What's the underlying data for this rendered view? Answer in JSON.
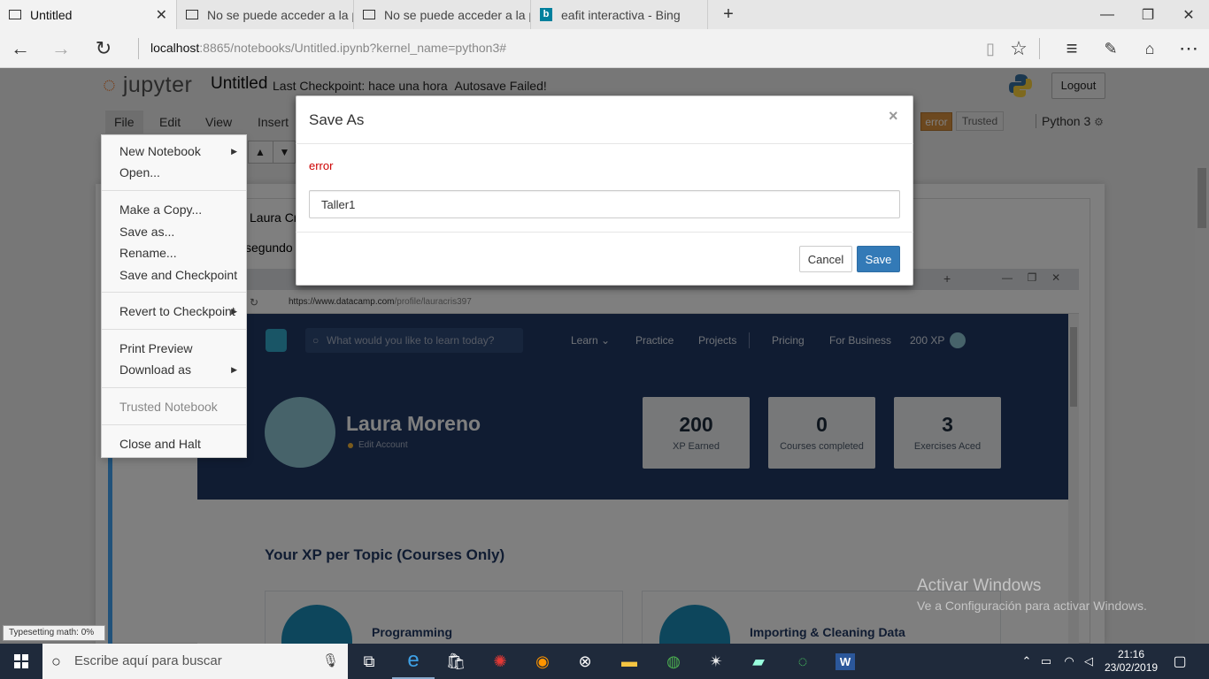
{
  "browser": {
    "tabs": [
      {
        "title": "Untitled",
        "active": true
      },
      {
        "title": "No se puede acceder a la pá"
      },
      {
        "title": "No se puede acceder a la pá"
      },
      {
        "title": "eafit interactiva - Bing"
      }
    ],
    "new_tab": "+",
    "url_host": "localhost",
    "url_rest": ":8865/notebooks/Untitled.ipynb?kernel_name=python3#",
    "window_controls": {
      "minimize": "—",
      "restore": "❐",
      "close": "✕"
    }
  },
  "jupyter": {
    "logo": "jupyter",
    "notebook_title": "Untitled",
    "checkpoint": "Last Checkpoint: hace una hora",
    "autosave": "Autosave Failed!",
    "logout": "Logout",
    "menus": [
      "File",
      "Edit",
      "View",
      "Insert"
    ],
    "file_menu": {
      "groups": [
        [
          {
            "label": "New Notebook",
            "submenu": true
          },
          {
            "label": "Open..."
          }
        ],
        [
          {
            "label": "Make a Copy..."
          },
          {
            "label": "Save as..."
          },
          {
            "label": "Rename..."
          },
          {
            "label": "Save and Checkpoint"
          }
        ],
        [
          {
            "label": "Revert to Checkpoint",
            "submenu": true
          }
        ],
        [
          {
            "label": "Print Preview"
          },
          {
            "label": "Download as",
            "submenu": true
          }
        ],
        [
          {
            "label": "Trusted Notebook",
            "disabled": true
          }
        ],
        [
          {
            "label": "Close and Halt"
          }
        ]
      ]
    },
    "error_badge": "error",
    "trusted": "Trusted",
    "kernel": "Python 3",
    "typesetting": "Typesetting math: 0%",
    "cell_text_1": "Laura Cris",
    "cell_text_2": "segundo"
  },
  "embedded": {
    "url_host": "https://www.datacamp.com",
    "url_path": "/profile/lauracris397",
    "search_placeholder": "What would you like to learn today?",
    "nav": [
      "Learn",
      "Practice",
      "Projects",
      "Pricing",
      "For Business",
      "200 XP"
    ],
    "name": "Laura Moreno",
    "edit_account": "Edit Account",
    "stats": [
      {
        "value": "200",
        "label": "XP Earned"
      },
      {
        "value": "0",
        "label": "Courses completed"
      },
      {
        "value": "3",
        "label": "Exercises Aced"
      }
    ],
    "section_title": "Your XP per Topic (Courses Only)",
    "topics": [
      "Programming",
      "Importing & Cleaning Data"
    ]
  },
  "modal": {
    "title": "Save As",
    "close": "×",
    "error": "error",
    "input_value": "Taller1",
    "cancel": "Cancel",
    "save": "Save"
  },
  "watermark": {
    "line1": "Activar Windows",
    "line2": "Ve a Configuración para activar Windows."
  },
  "taskbar": {
    "search_placeholder": "Escribe aquí para buscar",
    "time": "21:16",
    "date": "23/02/2019"
  }
}
